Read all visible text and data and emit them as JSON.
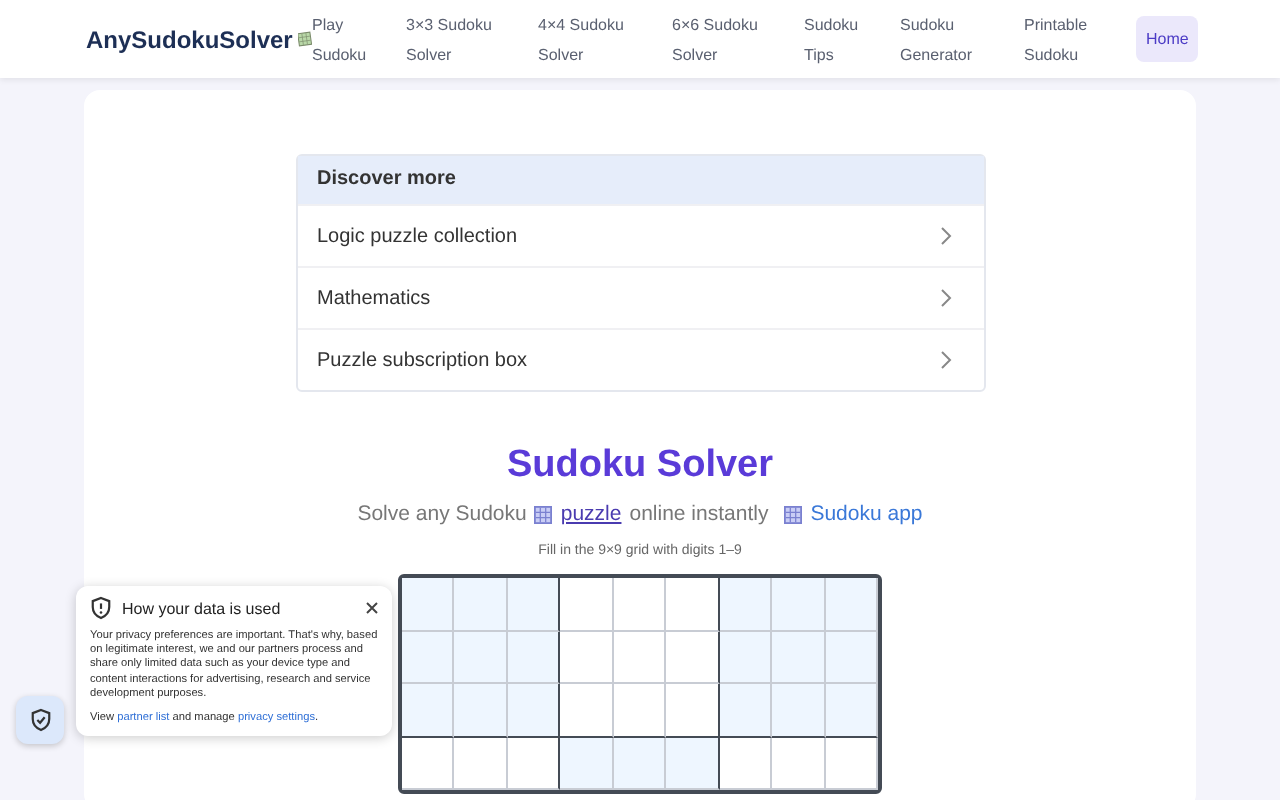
{
  "header": {
    "logo": "AnySudokuSolver",
    "nav": [
      {
        "label": "Play Sudoku",
        "selected": false
      },
      {
        "label": "3×3 Sudoku Solver",
        "selected": false
      },
      {
        "label": "4×4 Sudoku Solver",
        "selected": false
      },
      {
        "label": "6×6 Sudoku Solver",
        "selected": false
      },
      {
        "label": "Sudoku Tips",
        "selected": false
      },
      {
        "label": "Sudoku Generator",
        "selected": false
      },
      {
        "label": "Printable Sudoku",
        "selected": false
      },
      {
        "label": "Home",
        "selected": true
      }
    ]
  },
  "discover": {
    "title": "Discover more",
    "items": [
      "Logic puzzle collection",
      "Mathematics",
      "Puzzle subscription box"
    ]
  },
  "solver": {
    "title": "Sudoku Solver",
    "subtitle_start": "Solve any Sudoku",
    "subtitle_link": "puzzle",
    "subtitle_end": "online instantly",
    "app_link": "Sudoku app",
    "hint": "Fill in the 9×9 grid with digits 1–9"
  },
  "privacy": {
    "title": "How your data is used",
    "body": "Your privacy preferences are important. That's why, based on legitimate interest, we and our partners process and share only limited data such as your device type and content interactions for advertising, research and service development purposes.",
    "view": "View",
    "partner_link": "partner list",
    "manage": "and manage",
    "settings_link": "privacy settings",
    "end": "."
  }
}
